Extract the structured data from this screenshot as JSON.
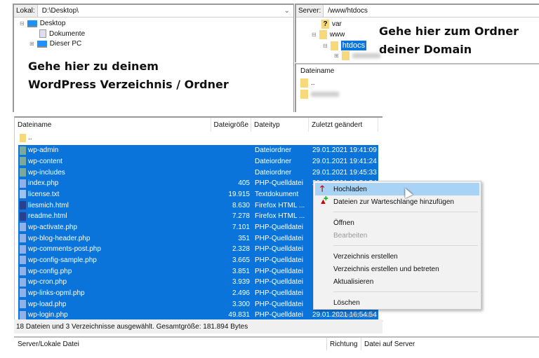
{
  "local": {
    "label": "Lokal:",
    "path": "D:\\Desktop\\",
    "tree": [
      "Desktop",
      "Dokumente",
      "Dieser PC"
    ],
    "annotation": [
      "Gehe hier zu deinem",
      "WordPress Verzeichnis / Ordner"
    ]
  },
  "server": {
    "label": "Server:",
    "path": "/www/htdocs",
    "tree": [
      "var",
      "www",
      "htdocs"
    ],
    "annotation": [
      "Gehe hier zum Ordner",
      "deiner Domain"
    ],
    "list_header": "Dateiname",
    "list": [
      ".."
    ]
  },
  "filelist": {
    "columns": [
      "Dateiname",
      "Dateigröße",
      "Dateityp",
      "Zuletzt geändert"
    ],
    "parent": "..",
    "rows": [
      {
        "name": "wp-admin",
        "size": "",
        "type": "Dateiordner",
        "date": "29.01.2021 19:41:09",
        "kind": "folder"
      },
      {
        "name": "wp-content",
        "size": "",
        "type": "Dateiordner",
        "date": "29.01.2021 19:41:24",
        "kind": "folder"
      },
      {
        "name": "wp-includes",
        "size": "",
        "type": "Dateiordner",
        "date": "29.01.2021 19:45:33",
        "kind": "folder"
      },
      {
        "name": "index.php",
        "size": "405",
        "type": "PHP-Quelldatei",
        "date": "29.01.2021 16:54:54",
        "kind": "php"
      },
      {
        "name": "license.txt",
        "size": "19.915",
        "type": "Textdokument",
        "date": "",
        "kind": "txt"
      },
      {
        "name": "liesmich.html",
        "size": "8.630",
        "type": "Firefox HTML ...",
        "date": "",
        "kind": "html"
      },
      {
        "name": "readme.html",
        "size": "7.278",
        "type": "Firefox HTML ...",
        "date": "",
        "kind": "html"
      },
      {
        "name": "wp-activate.php",
        "size": "7.101",
        "type": "PHP-Quelldatei",
        "date": "",
        "kind": "php"
      },
      {
        "name": "wp-blog-header.php",
        "size": "351",
        "type": "PHP-Quelldatei",
        "date": "",
        "kind": "php"
      },
      {
        "name": "wp-comments-post.php",
        "size": "2.328",
        "type": "PHP-Quelldatei",
        "date": "",
        "kind": "php"
      },
      {
        "name": "wp-config-sample.php",
        "size": "3.665",
        "type": "PHP-Quelldatei",
        "date": "",
        "kind": "php"
      },
      {
        "name": "wp-config.php",
        "size": "3.851",
        "type": "PHP-Quelldatei",
        "date": "",
        "kind": "php"
      },
      {
        "name": "wp-cron.php",
        "size": "3.939",
        "type": "PHP-Quelldatei",
        "date": "",
        "kind": "php"
      },
      {
        "name": "wp-links-opml.php",
        "size": "2.496",
        "type": "PHP-Quelldatei",
        "date": "",
        "kind": "php"
      },
      {
        "name": "wp-load.php",
        "size": "3.300",
        "type": "PHP-Quelldatei",
        "date": "",
        "kind": "php"
      },
      {
        "name": "wp-login.php",
        "size": "49.831",
        "type": "PHP-Quelldatei",
        "date": "29.01.2021 16:54:54",
        "kind": "php"
      }
    ],
    "status": "18 Dateien und 3 Verzeichnisse ausgewählt. Gesamtgröße: 181.894 Bytes"
  },
  "context_menu": {
    "items": [
      {
        "label": "Hochladen",
        "icon": "upload-arrow-icon",
        "state": "highlighted"
      },
      {
        "label": "Dateien zur Warteschlange hinzufügen",
        "icon": "add-to-queue-icon",
        "state": "enabled"
      },
      {
        "sep": true
      },
      {
        "label": "Öffnen",
        "state": "enabled"
      },
      {
        "label": "Bearbeiten",
        "state": "disabled"
      },
      {
        "sep": true
      },
      {
        "label": "Verzeichnis erstellen",
        "state": "enabled"
      },
      {
        "label": "Verzeichnis erstellen und betreten",
        "state": "enabled"
      },
      {
        "label": "Aktualisieren",
        "state": "enabled"
      },
      {
        "sep": true
      },
      {
        "label": "Löschen",
        "state": "enabled"
      },
      {
        "label": "Umbenennen",
        "state": "disabled"
      }
    ]
  },
  "queue": {
    "columns": [
      "Server/Lokale Datei",
      "Richtung",
      "Datei auf Server"
    ]
  },
  "colors": {
    "selection": "#0a74da",
    "menu_highlight": "#a9d3f5",
    "folder": "#f7d87a"
  }
}
